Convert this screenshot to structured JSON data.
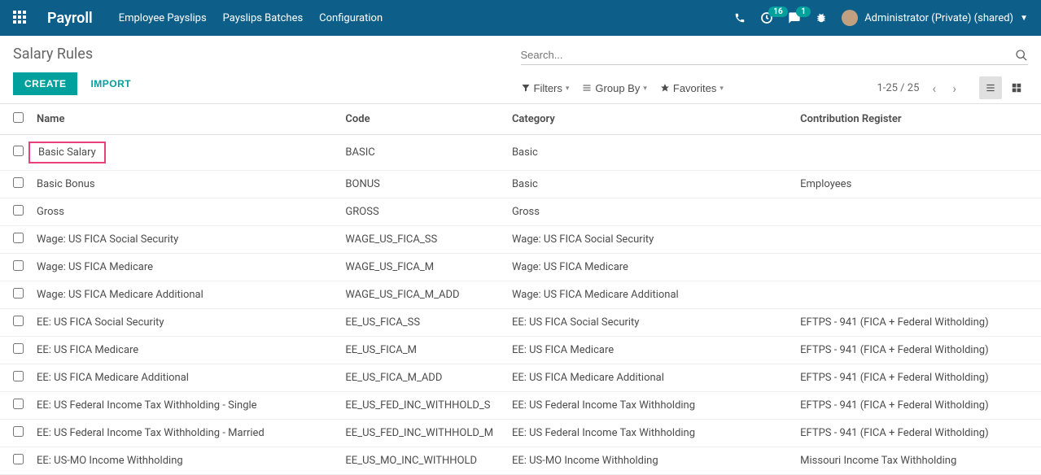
{
  "navbar": {
    "brand": "Payroll",
    "links": [
      "Employee Payslips",
      "Payslips Batches",
      "Configuration"
    ],
    "clock_badge": "16",
    "chat_badge": "1",
    "user_label": "Administrator (Private) (shared)"
  },
  "breadcrumb": "Salary Rules",
  "buttons": {
    "create": "CREATE",
    "import": "IMPORT"
  },
  "search": {
    "placeholder": "Search..."
  },
  "filters": {
    "filters_label": "Filters",
    "groupby_label": "Group By",
    "favorites_label": "Favorites"
  },
  "pager": "1-25 / 25",
  "columns": {
    "name": "Name",
    "code": "Code",
    "category": "Category",
    "contribution": "Contribution Register"
  },
  "rows": [
    {
      "name": "Basic Salary",
      "code": "BASIC",
      "category": "Basic",
      "contribution": "",
      "highlight": true
    },
    {
      "name": "Basic Bonus",
      "code": "BONUS",
      "category": "Basic",
      "contribution": "Employees"
    },
    {
      "name": "Gross",
      "code": "GROSS",
      "category": "Gross",
      "contribution": ""
    },
    {
      "name": "Wage: US FICA Social Security",
      "code": "WAGE_US_FICA_SS",
      "category": "Wage: US FICA Social Security",
      "contribution": ""
    },
    {
      "name": "Wage: US FICA Medicare",
      "code": "WAGE_US_FICA_M",
      "category": "Wage: US FICA Medicare",
      "contribution": ""
    },
    {
      "name": "Wage: US FICA Medicare Additional",
      "code": "WAGE_US_FICA_M_ADD",
      "category": "Wage: US FICA Medicare Additional",
      "contribution": ""
    },
    {
      "name": "EE: US FICA Social Security",
      "code": "EE_US_FICA_SS",
      "category": "EE: US FICA Social Security",
      "contribution": "EFTPS - 941 (FICA + Federal Witholding)"
    },
    {
      "name": "EE: US FICA Medicare",
      "code": "EE_US_FICA_M",
      "category": "EE: US FICA Medicare",
      "contribution": "EFTPS - 941 (FICA + Federal Witholding)"
    },
    {
      "name": "EE: US FICA Medicare Additional",
      "code": "EE_US_FICA_M_ADD",
      "category": "EE: US FICA Medicare Additional",
      "contribution": "EFTPS - 941 (FICA + Federal Witholding)"
    },
    {
      "name": "EE: US Federal Income Tax Withholding - Single",
      "code": "EE_US_FED_INC_WITHHOLD_S",
      "category": "EE: US Federal Income Tax Withholding",
      "contribution": "EFTPS - 941 (FICA + Federal Witholding)"
    },
    {
      "name": "EE: US Federal Income Tax Withholding - Married",
      "code": "EE_US_FED_INC_WITHHOLD_M",
      "category": "EE: US Federal Income Tax Withholding",
      "contribution": "EFTPS - 941 (FICA + Federal Witholding)"
    },
    {
      "name": "EE: US-MO Income Withholding",
      "code": "EE_US_MO_INC_WITHHOLD",
      "category": "EE: US-MO Income Withholding",
      "contribution": "Missouri Income Tax Withholding"
    }
  ]
}
